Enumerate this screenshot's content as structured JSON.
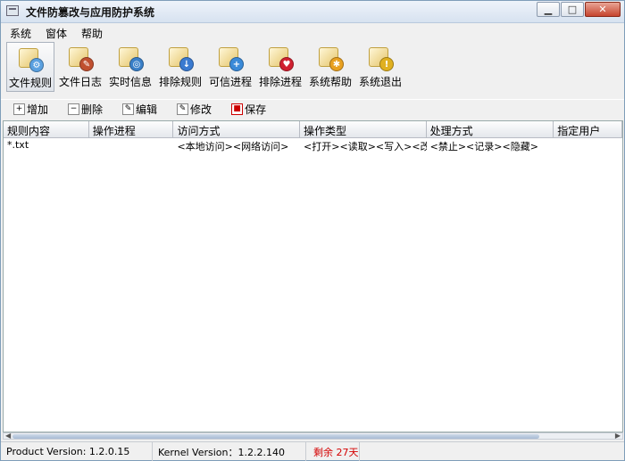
{
  "window": {
    "title": "文件防篡改与应用防护系统"
  },
  "menu": [
    "系统",
    "窗体",
    "帮助"
  ],
  "big_toolbar": [
    {
      "label": "文件规则",
      "icon": "file-rules-icon",
      "color": "#5aa0e0",
      "glyph": "⚙"
    },
    {
      "label": "文件日志",
      "icon": "file-log-icon",
      "color": "#c05030",
      "glyph": "✎"
    },
    {
      "label": "实时信息",
      "icon": "realtime-info-icon",
      "color": "#3a80c8",
      "glyph": "◎"
    },
    {
      "label": "排除规则",
      "icon": "exclude-rules-icon",
      "color": "#3a7ad0",
      "glyph": "↓"
    },
    {
      "label": "可信进程",
      "icon": "trusted-process-icon",
      "color": "#3a8ad8",
      "glyph": "+"
    },
    {
      "label": "排除进程",
      "icon": "exclude-process-icon",
      "color": "#d02030",
      "glyph": "♥"
    },
    {
      "label": "系统帮助",
      "icon": "system-help-icon",
      "color": "#e8a020",
      "glyph": "✱"
    },
    {
      "label": "系统退出",
      "icon": "system-exit-icon",
      "color": "#e0b020",
      "glyph": "!"
    }
  ],
  "small_toolbar": [
    {
      "label": "增加",
      "icon": "add-icon",
      "glyph": "+"
    },
    {
      "label": "删除",
      "icon": "delete-icon",
      "glyph": "−"
    },
    {
      "label": "编辑",
      "icon": "edit-icon",
      "glyph": "✎"
    },
    {
      "label": "修改",
      "icon": "modify-icon",
      "glyph": "✎"
    },
    {
      "label": "保存",
      "icon": "save-icon",
      "glyph": "■"
    }
  ],
  "table": {
    "columns": [
      "规则内容",
      "操作进程",
      "访问方式",
      "操作类型",
      "处理方式",
      "指定用户"
    ],
    "rows": [
      [
        "*.txt",
        "",
        "<本地访问><网络访问>",
        "<打开><读取><写入><改…",
        "<禁止><记录><隐藏>",
        ""
      ]
    ]
  },
  "status": {
    "product_version": "Product Version: 1.2.0.15",
    "kernel_version": "Kernel Version：1.2.2.140",
    "remaining": "剩余  27天"
  }
}
